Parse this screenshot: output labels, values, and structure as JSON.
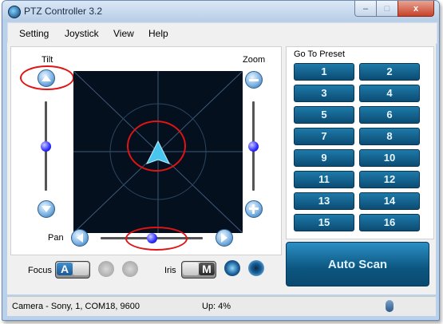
{
  "window": {
    "title": "PTZ Controller 3.2",
    "close_label": "x",
    "icon": "camera-app-icon"
  },
  "menu": [
    "Setting",
    "Joystick",
    "View",
    "Help"
  ],
  "ptz": {
    "tilt_label": "Tilt",
    "zoom_label": "Zoom",
    "pan_label": "Pan",
    "tilt_level": 0.5,
    "zoom_level": 0.5,
    "pan_level": 0.5
  },
  "focus": {
    "label": "Focus",
    "mode": "A",
    "near_icon": "focus-near-icon",
    "far_icon": "focus-far-icon"
  },
  "iris": {
    "label": "Iris",
    "mode": "M",
    "open_icon": "iris-open-icon",
    "close_icon": "iris-close-icon"
  },
  "preset": {
    "title": "Go To Preset",
    "buttons": [
      "1",
      "2",
      "3",
      "4",
      "5",
      "6",
      "7",
      "8",
      "9",
      "10",
      "11",
      "12",
      "13",
      "14",
      "15",
      "16"
    ]
  },
  "auto_scan_label": "Auto Scan",
  "status": {
    "camera": "Camera - Sony, 1, COM18, 9600",
    "action": "Up: 4%"
  },
  "colors": {
    "accent": "#0b4c74",
    "highlight_ring": "#e01414",
    "joystick_bg": "#05101e"
  }
}
